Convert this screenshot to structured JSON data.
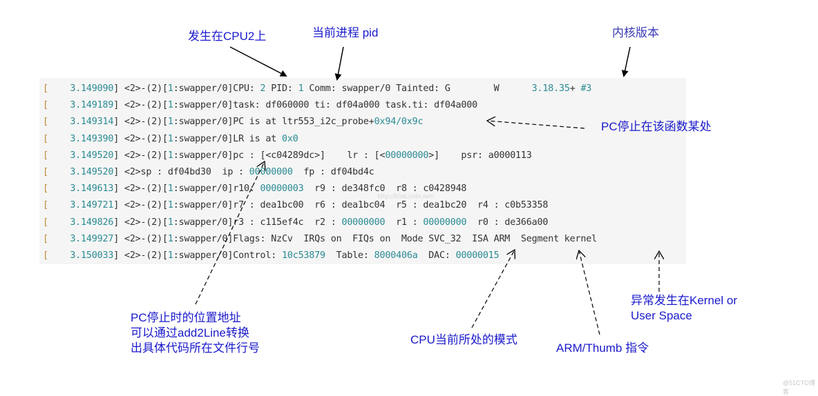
{
  "log": {
    "lines": [
      {
        "bracket": "[",
        "ts": "    3.149090]",
        "parts": [
          {
            "t": " <2>-(2)[",
            "c": "txt"
          },
          {
            "t": "1",
            "c": "num"
          },
          {
            "t": ":swapper/0]CPU: ",
            "c": "txt"
          },
          {
            "t": "2",
            "c": "num"
          },
          {
            "t": " PID: ",
            "c": "txt"
          },
          {
            "t": "1",
            "c": "num"
          },
          {
            "t": " Comm: swapper/0 Tainted: G        W      ",
            "c": "txt"
          },
          {
            "t": "3.18.35",
            "c": "num"
          },
          {
            "t": "+ ",
            "c": "txt"
          },
          {
            "t": "#3",
            "c": "num"
          }
        ]
      },
      {
        "bracket": "[",
        "ts": "    3.149189]",
        "parts": [
          {
            "t": " <2>-(2)[",
            "c": "txt"
          },
          {
            "t": "1",
            "c": "num"
          },
          {
            "t": ":swapper/0]task: df060000 ti: df04a000 task.ti: df04a000",
            "c": "txt"
          }
        ]
      },
      {
        "bracket": "[",
        "ts": "    3.149314]",
        "parts": [
          {
            "t": " <2>-(2)[",
            "c": "txt"
          },
          {
            "t": "1",
            "c": "num"
          },
          {
            "t": ":swapper/0]PC is at ltr553_i2c_probe+",
            "c": "txt"
          },
          {
            "t": "0x94/0x9c",
            "c": "num"
          }
        ]
      },
      {
        "bracket": "[",
        "ts": "    3.149390]",
        "parts": [
          {
            "t": " <2>-(2)[",
            "c": "txt"
          },
          {
            "t": "1",
            "c": "num"
          },
          {
            "t": ":swapper/0]LR is at ",
            "c": "txt"
          },
          {
            "t": "0x0",
            "c": "num"
          }
        ]
      },
      {
        "bracket": "[",
        "ts": "    3.149520]",
        "parts": [
          {
            "t": " <2>-(2)[",
            "c": "txt"
          },
          {
            "t": "1",
            "c": "num"
          },
          {
            "t": ":swapper/0]pc : [<c04289dc>]    lr : [<",
            "c": "txt"
          },
          {
            "t": "00000000",
            "c": "num"
          },
          {
            "t": ">]    psr: a0000113",
            "c": "txt"
          }
        ]
      },
      {
        "bracket": "[",
        "ts": "    3.149520]",
        "parts": [
          {
            "t": " <2>sp : df04bd30  ip : ",
            "c": "txt"
          },
          {
            "t": "00000000",
            "c": "num"
          },
          {
            "t": "  fp : df04bd4c",
            "c": "txt"
          }
        ]
      },
      {
        "bracket": "[",
        "ts": "    3.149613]",
        "parts": [
          {
            "t": " <2>-(2)[",
            "c": "txt"
          },
          {
            "t": "1",
            "c": "num"
          },
          {
            "t": ":swapper/0]r10: ",
            "c": "txt"
          },
          {
            "t": "00000003",
            "c": "num"
          },
          {
            "t": "  r9 : de348fc0  r8 : c0428948",
            "c": "txt"
          }
        ]
      },
      {
        "bracket": "[",
        "ts": "    3.149721]",
        "parts": [
          {
            "t": " <2>-(2)[",
            "c": "txt"
          },
          {
            "t": "1",
            "c": "num"
          },
          {
            "t": ":swapper/0]r7 : dea1bc00  r6 : dea1bc04  r5 : dea1bc20  r4 : c0b53358",
            "c": "txt"
          }
        ]
      },
      {
        "bracket": "[",
        "ts": "    3.149826]",
        "parts": [
          {
            "t": " <2>-(2)[",
            "c": "txt"
          },
          {
            "t": "1",
            "c": "num"
          },
          {
            "t": ":swapper/0]r3 : c115ef4c  r2 : ",
            "c": "txt"
          },
          {
            "t": "00000000",
            "c": "num"
          },
          {
            "t": "  r1 : ",
            "c": "txt"
          },
          {
            "t": "00000000",
            "c": "num"
          },
          {
            "t": "  r0 : de366a00",
            "c": "txt"
          }
        ]
      },
      {
        "bracket": "[",
        "ts": "    3.149927]",
        "parts": [
          {
            "t": " <2>-(2)[",
            "c": "txt"
          },
          {
            "t": "1",
            "c": "num"
          },
          {
            "t": ":swapper/0]Flags: NzCv  IRQs on  FIQs on  Mode SVC_32  ISA ARM  Segment kernel",
            "c": "txt"
          }
        ]
      },
      {
        "bracket": "[",
        "ts": "    3.150033]",
        "parts": [
          {
            "t": " <2>-(2)[",
            "c": "txt"
          },
          {
            "t": "1",
            "c": "num"
          },
          {
            "t": ":swapper/0]Control: ",
            "c": "txt"
          },
          {
            "t": "10c53879",
            "c": "num"
          },
          {
            "t": "  Table: ",
            "c": "txt"
          },
          {
            "t": "8000406a",
            "c": "num"
          },
          {
            "t": "  DAC: ",
            "c": "txt"
          },
          {
            "t": "00000015",
            "c": "num"
          }
        ]
      }
    ]
  },
  "annotations": {
    "cpu": "发生在CPU2上",
    "pid": "当前进程 pid",
    "kernel_version": "内核版本",
    "pc_func": "PC停止在该函数某处",
    "pc_addr_1": "PC停止时的位置地址",
    "pc_addr_2": "可以通过add2Line转换",
    "pc_addr_3": "出具体代码所在文件行号",
    "cpu_mode": "CPU当前所处的模式",
    "isa": "ARM/Thumb 指令",
    "segment_1": "异常发生在Kernel or",
    "segment_2": "User Space"
  },
  "watermarks": {
    "inline": "http://blog.csdn.net/",
    "corner": "@51CTO博客"
  },
  "colors": {
    "annotation_text": "#1a1acc",
    "log_background": "#f5f5f5",
    "log_number": "#2a8a93",
    "log_bracket": "#c08a3a",
    "log_text": "#333333"
  }
}
